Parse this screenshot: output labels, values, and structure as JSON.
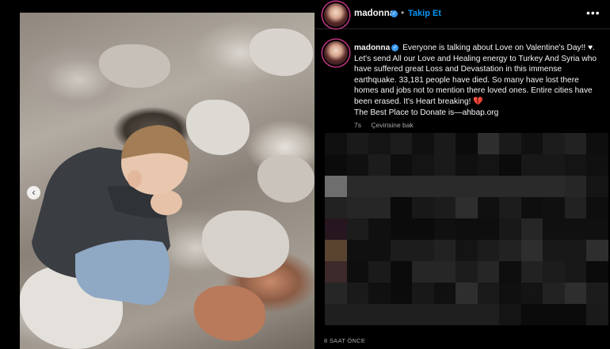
{
  "post": {
    "username": "madonna",
    "follow_label": "Takip Et",
    "dot": "•",
    "more_icon": "more-icon",
    "caption_username": "madonna",
    "caption_text_1": "Everyone is talking about Love  on Valentine's Day!! ♥. Let's send All our Love and Healing  energy to Turkey And Syria who have suffered great Loss and Devastation in this immense earthquake.  33,181 people have died.  So many  have lost there homes and jobs not to mention there loved ones.  Entire cities have been erased. It's Heart breaking!",
    "broken_heart": "💔",
    "caption_text_2": "The Best Place to Donate is—ahbap.org",
    "time_ago": "7s",
    "translate_label": "Çevirisine bak",
    "timestamp": "8 SAAT ÖNCE",
    "nav_arrow": "‹",
    "verified_mark": "✓"
  },
  "colors": {
    "background": "#000000",
    "accent_blue": "#0095f6",
    "verified_blue": "#3897f0",
    "muted_text": "#a8a8a8",
    "heart_red": "#e0245e"
  }
}
